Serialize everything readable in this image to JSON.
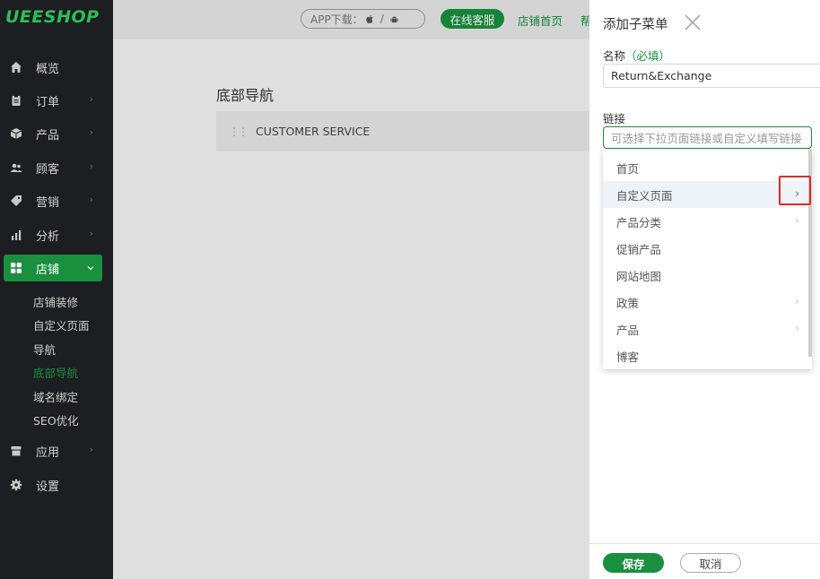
{
  "brand": {
    "logo_text": "UEESHOP",
    "accent": "#1a8f3e"
  },
  "sidebar": {
    "items": [
      {
        "label": "概览",
        "icon": "home-icon"
      },
      {
        "label": "订单",
        "icon": "clipboard-icon"
      },
      {
        "label": "产品",
        "icon": "box-icon"
      },
      {
        "label": "顾客",
        "icon": "users-icon"
      },
      {
        "label": "营销",
        "icon": "tag-icon"
      },
      {
        "label": "分析",
        "icon": "bar-chart-icon"
      },
      {
        "label": "店铺",
        "icon": "grid-icon"
      },
      {
        "label": "应用",
        "icon": "store-icon"
      },
      {
        "label": "设置",
        "icon": "gear-icon"
      }
    ],
    "sub_items": [
      "店铺装修",
      "自定义页面",
      "导航",
      "底部导航",
      "域名绑定",
      "SEO优化"
    ]
  },
  "topbar": {
    "app_download": "APP下载：",
    "separator": "/",
    "online_service": "在线客服",
    "shop_home": "店铺首页",
    "help_partial": "帮"
  },
  "main": {
    "title": "底部导航",
    "card_label": "CUSTOMER SERVICE"
  },
  "drawer": {
    "title": "添加子菜单",
    "name_label": "名称",
    "name_required": "（必填）",
    "name_value": "Return&Exchange",
    "link_label": "链接",
    "link_placeholder": "可选择下拉页面链接或自定义填写链接",
    "dropdown": [
      "首页",
      "自定义页面",
      "产品分类",
      "促销产品",
      "网站地图",
      "政策",
      "产品",
      "博客"
    ],
    "save": "保存",
    "cancel": "取消"
  }
}
